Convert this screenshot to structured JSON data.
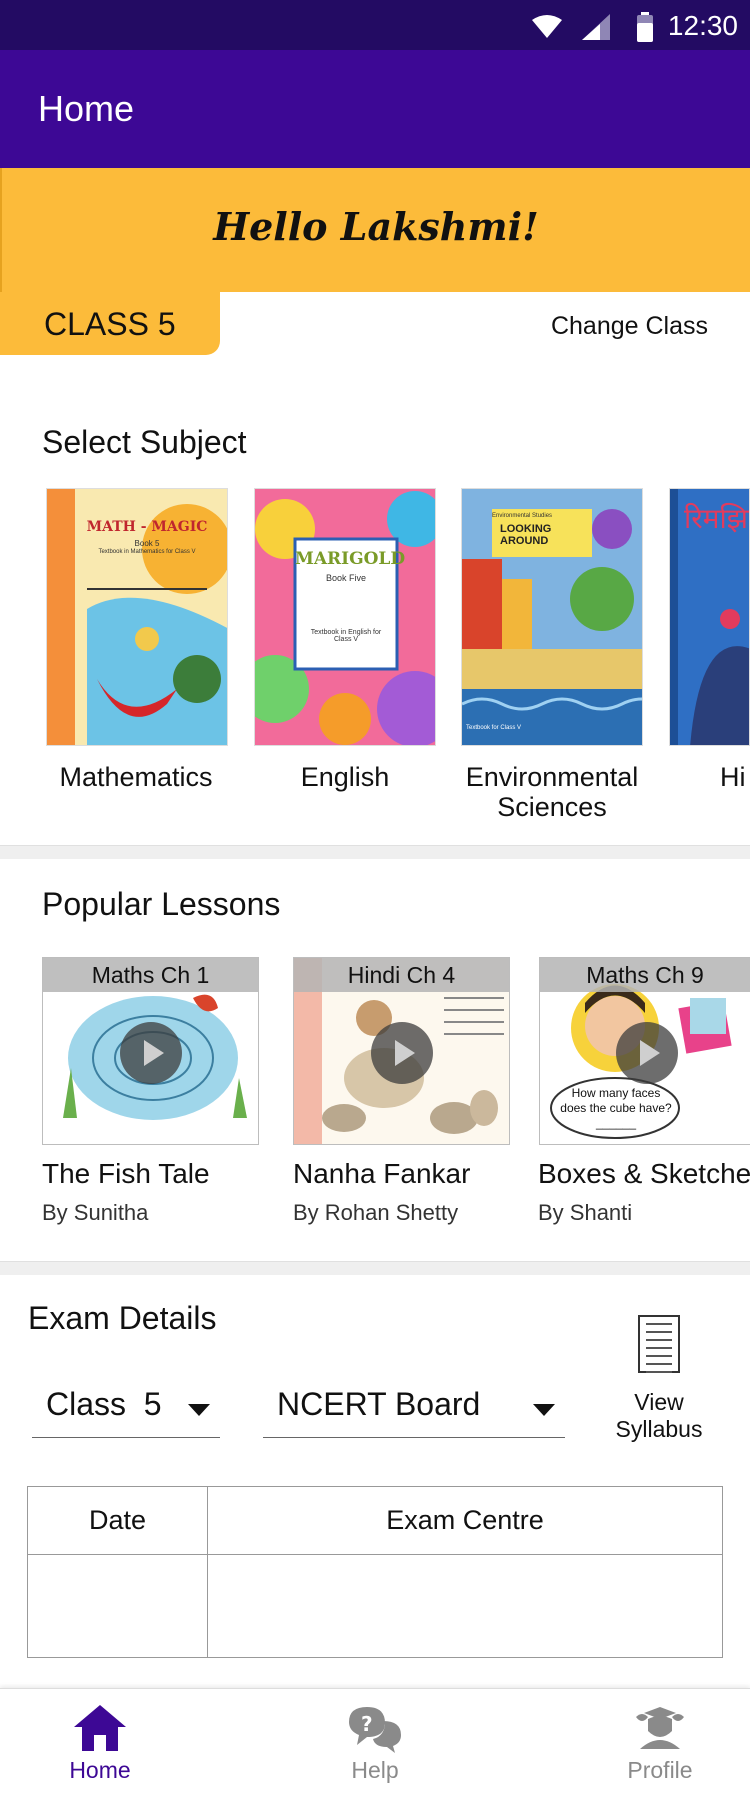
{
  "status_bar": {
    "time": "12:30",
    "icons": [
      "wifi-icon",
      "signal-icon",
      "battery-icon"
    ]
  },
  "app_bar": {
    "title": "Home"
  },
  "greeting": "Hello Lakshmi!",
  "class_info": {
    "label": "CLASS 5",
    "change_label": "Change Class"
  },
  "subjects": {
    "title": "Select Subject",
    "items": [
      {
        "label": "Mathematics",
        "cover_title": "MATH - MAGIC",
        "cover_subtitle": "Book 5",
        "cover_note": "Textbook in Mathematics for Class V"
      },
      {
        "label": "English",
        "cover_title": "MARIGOLD",
        "cover_subtitle": "Book Five",
        "cover_note": "Textbook in English for Class V"
      },
      {
        "label": "Environmental Sciences",
        "cover_title": "LOOKING AROUND",
        "cover_subtitle": "Environmental Studies",
        "cover_note": "Textbook for Class V"
      },
      {
        "label": "Hi",
        "cover_title": "रिमझिम",
        "cover_subtitle": "",
        "cover_note": ""
      }
    ]
  },
  "lessons": {
    "title": "Popular Lessons",
    "items": [
      {
        "chip": "Maths Ch 1",
        "title": "The Fish Tale",
        "author": "By Sunitha"
      },
      {
        "chip": "Hindi Ch 4",
        "title": "Nanha Fankar",
        "author": "By Rohan Shetty"
      },
      {
        "chip": "Maths Ch 9",
        "title": "Boxes & Sketche",
        "author": "By Shanti",
        "thumb_text": "How many faces does the cube have? ______"
      }
    ]
  },
  "exam": {
    "title": "Exam Details",
    "class_label": "Class",
    "class_value": "5",
    "board": "NCERT Board",
    "view_syllabus": "View Syllabus",
    "columns": [
      "Date",
      "Exam Centre"
    ],
    "rows": [
      [
        "",
        ""
      ]
    ]
  },
  "bottom_nav": [
    {
      "label": "Home",
      "icon": "home-icon",
      "active": true
    },
    {
      "label": "Help",
      "icon": "help-icon",
      "active": false
    },
    {
      "label": "Profile",
      "icon": "profile-icon",
      "active": false
    }
  ],
  "colors": {
    "status_bar": "#230b63",
    "app_bar": "#3d0895",
    "accent_yellow": "#fcbb3a",
    "nav_active": "#3d0895",
    "nav_inactive": "#8a8a8a"
  }
}
